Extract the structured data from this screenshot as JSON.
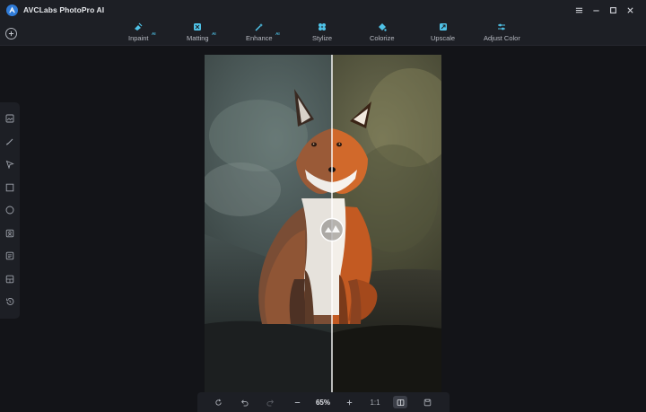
{
  "app": {
    "title": "AVCLabs PhotoPro AI"
  },
  "toolbar": {
    "tools": [
      {
        "label": "Inpaint",
        "icon": "inpaint-icon",
        "badge": "AI"
      },
      {
        "label": "Matting",
        "icon": "matting-icon",
        "badge": "AI"
      },
      {
        "label": "Enhance",
        "icon": "enhance-icon",
        "badge": "AI"
      },
      {
        "label": "Stylize",
        "icon": "stylize-icon",
        "badge": ""
      },
      {
        "label": "Colorize",
        "icon": "colorize-icon",
        "badge": ""
      },
      {
        "label": "Upscale",
        "icon": "upscale-icon",
        "badge": ""
      },
      {
        "label": "Adjust Color",
        "icon": "adjust-color-icon",
        "badge": ""
      }
    ]
  },
  "sidebar": {
    "tools": [
      "image-icon",
      "brush-icon",
      "pointer-icon",
      "rectangle-icon",
      "circle-icon",
      "portrait-icon",
      "text-block-icon",
      "gallery-icon",
      "history-icon"
    ]
  },
  "bottom": {
    "zoom": "65%",
    "ratio": "1:1"
  },
  "colors": {
    "accent": "#4fc3e8",
    "background": "#131418",
    "panel": "#1d1f25"
  }
}
